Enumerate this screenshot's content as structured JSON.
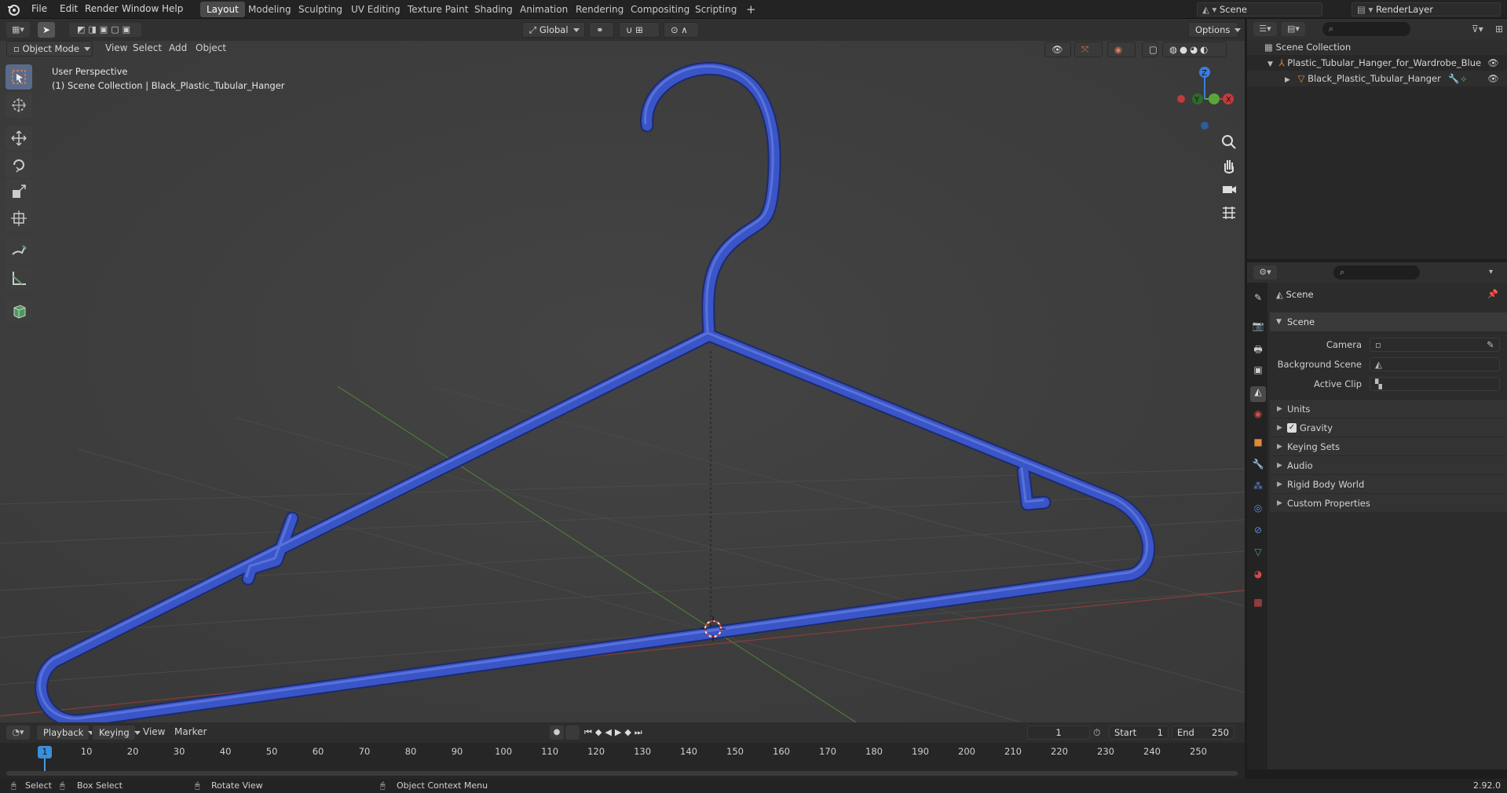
{
  "app": {
    "menus": [
      "File",
      "Edit",
      "Render",
      "Window",
      "Help"
    ],
    "workspaces": [
      "Layout",
      "Modeling",
      "Sculpting",
      "UV Editing",
      "Texture Paint",
      "Shading",
      "Animation",
      "Rendering",
      "Compositing",
      "Scripting"
    ],
    "active_workspace": "Layout",
    "scene_name": "Scene",
    "view_layer": "RenderLayer",
    "version": "2.92.0"
  },
  "viewport_header": {
    "mode": "Object Mode",
    "menus": [
      "View",
      "Select",
      "Add",
      "Object"
    ],
    "orientation": "Global",
    "options_label": "Options"
  },
  "viewport": {
    "perspective_label": "User Perspective",
    "collection_label": "(1) Scene Collection | Black_Plastic_Tubular_Hanger",
    "object_color": "#3a55c8",
    "gizmo": {
      "x": "X",
      "y": "Y",
      "z": "Z"
    }
  },
  "outliner": {
    "root": "Scene Collection",
    "items": [
      {
        "label": "Plastic_Tubular_Hanger_for_Wardrobe_Blue",
        "type": "empty"
      },
      {
        "label": "Black_Plastic_Tubular_Hanger",
        "type": "mesh"
      }
    ]
  },
  "properties": {
    "context": "Scene",
    "panel_title": "Scene",
    "fields": [
      {
        "label": "Camera",
        "value": ""
      },
      {
        "label": "Background Scene",
        "value": ""
      },
      {
        "label": "Active Clip",
        "value": ""
      }
    ],
    "subpanels": [
      "Units",
      "Gravity",
      "Keying Sets",
      "Audio",
      "Rigid Body World",
      "Custom Properties"
    ],
    "gravity_checked": true
  },
  "timeline": {
    "menus": [
      "Playback",
      "Keying",
      "View",
      "Marker"
    ],
    "current_frame": "1",
    "start_label": "Start",
    "start": "1",
    "end_label": "End",
    "end": "250",
    "ticks": [
      "1",
      "10",
      "20",
      "30",
      "40",
      "50",
      "60",
      "70",
      "80",
      "90",
      "100",
      "110",
      "120",
      "130",
      "140",
      "150",
      "160",
      "170",
      "180",
      "190",
      "200",
      "210",
      "220",
      "230",
      "240",
      "250"
    ]
  },
  "statusbar": {
    "select": "Select",
    "box_select": "Box Select",
    "rotate": "Rotate View",
    "context_menu": "Object Context Menu"
  }
}
